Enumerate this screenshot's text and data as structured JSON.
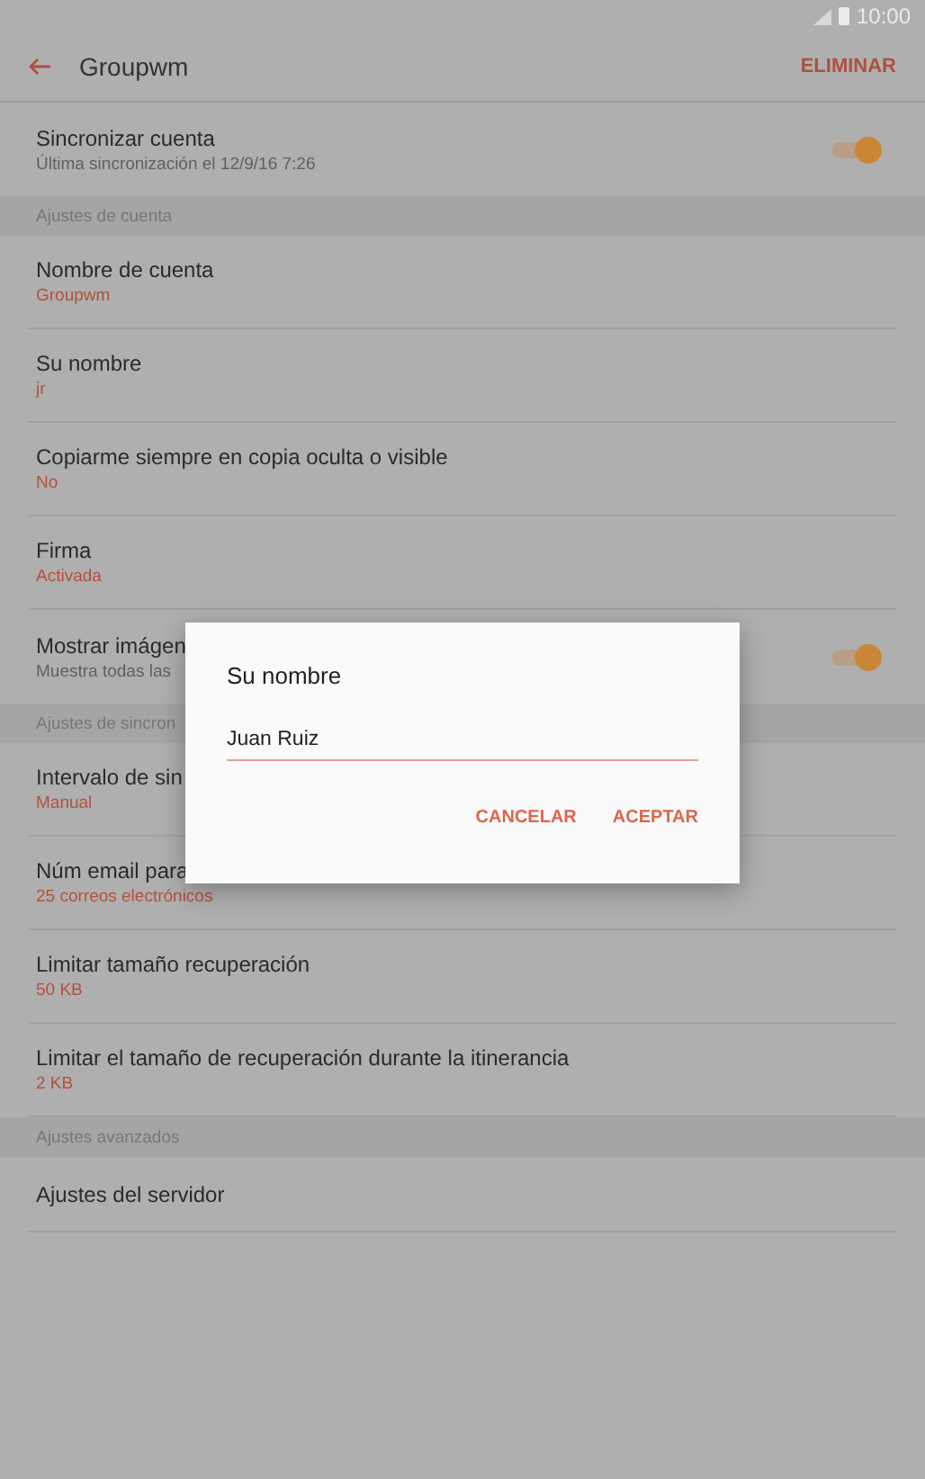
{
  "status_bar": {
    "time": "10:00"
  },
  "toolbar": {
    "title": "Groupwm",
    "action": "ELIMINAR"
  },
  "list": [
    {
      "kind": "toggle",
      "title": "Sincronizar cuenta",
      "subtitle": "Última sincronización el 12/9/16  7:26",
      "on": true
    },
    {
      "kind": "section",
      "title": "Ajustes de cuenta"
    },
    {
      "kind": "value",
      "title": "Nombre de cuenta",
      "subtitle": "Groupwm"
    },
    {
      "kind": "value",
      "title": "Su nombre",
      "subtitle": "jr"
    },
    {
      "kind": "value",
      "title": "Copiarme siempre en copia oculta o visible",
      "subtitle": "No"
    },
    {
      "kind": "value",
      "title": "Firma",
      "subtitle": "Activada"
    },
    {
      "kind": "toggle",
      "title": "Mostrar imágen",
      "subtitle": "Muestra todas las",
      "on": true
    },
    {
      "kind": "section",
      "title": "Ajustes de sincron"
    },
    {
      "kind": "value",
      "title": "Intervalo de sin",
      "subtitle": "Manual"
    },
    {
      "kind": "value",
      "title": "Núm email para",
      "subtitle": "25 correos electrónicos"
    },
    {
      "kind": "value",
      "title": "Limitar tamaño recuperación",
      "subtitle": "50 KB"
    },
    {
      "kind": "value",
      "title": "Limitar el tamaño de recuperación durante la itinerancia",
      "subtitle": "2 KB"
    },
    {
      "kind": "section",
      "title": "Ajustes avanzados"
    },
    {
      "kind": "plain",
      "title": "Ajustes del servidor"
    }
  ],
  "dialog": {
    "title": "Su nombre",
    "value": "Juan Ruiz",
    "buttons": [
      "CANCELAR",
      "ACEPTAR"
    ]
  }
}
